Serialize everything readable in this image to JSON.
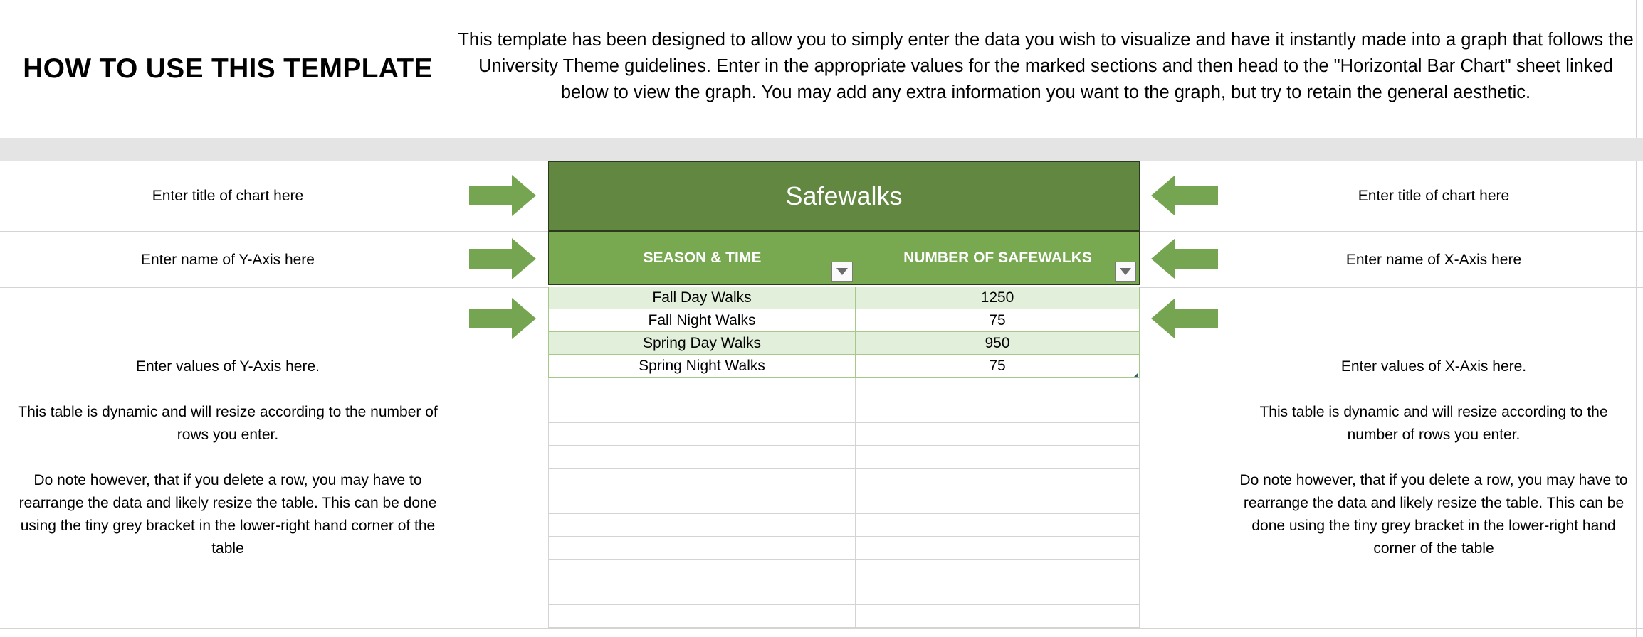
{
  "header": {
    "title": "HOW TO USE THIS TEMPLATE",
    "description": "This template has been designed to allow you to simply enter the data you wish to visualize and have it instantly made into a graph that follows the University Theme guidelines.  Enter in the appropriate values for the marked sections and then head to the \"Horizontal Bar Chart\" sheet linked below to view the graph. You may add any extra information you want to the graph, but try to retain the general aesthetic."
  },
  "left": {
    "title_instruction": "Enter title of chart here",
    "yaxis_instruction": "Enter name of Y-Axis here",
    "values_instruction": "Enter values of Y-Axis here.",
    "dynamic_note": "This table is dynamic and will resize according to the number of rows you enter.",
    "delete_note": "Do note however, that if you delete a row, you may have to rearrange the data and likely resize the table. This can be done using the tiny grey bracket in the lower-right hand corner of the table"
  },
  "right": {
    "title_instruction": "Enter title of chart here",
    "xaxis_instruction": "Enter name of X-Axis here",
    "values_instruction": "Enter values of X-Axis here.",
    "dynamic_note": "This table is dynamic and will resize according to the number of rows you enter.",
    "delete_note": "Do note however, that if you delete a row, you may have to rearrange the data and likely resize the table. This can be done using the tiny grey bracket in the lower-right hand corner of the table"
  },
  "table": {
    "title": "Safewalks",
    "columns": [
      "SEASON & TIME",
      "NUMBER OF SAFEWALKS"
    ],
    "rows": [
      [
        "Fall Day Walks",
        "1250"
      ],
      [
        "Fall Night Walks",
        "75"
      ],
      [
        "Spring Day Walks",
        "950"
      ],
      [
        "Spring Night Walks",
        "75"
      ]
    ]
  },
  "icons": {
    "arrow": "arrow-right-icon",
    "arrow_left": "arrow-left-icon",
    "filter": "dropdown-filter-icon"
  },
  "colors": {
    "title_bg": "#628740",
    "header_bg": "#78a950",
    "band_bg": "#e2efda",
    "arrow": "#76a551"
  }
}
